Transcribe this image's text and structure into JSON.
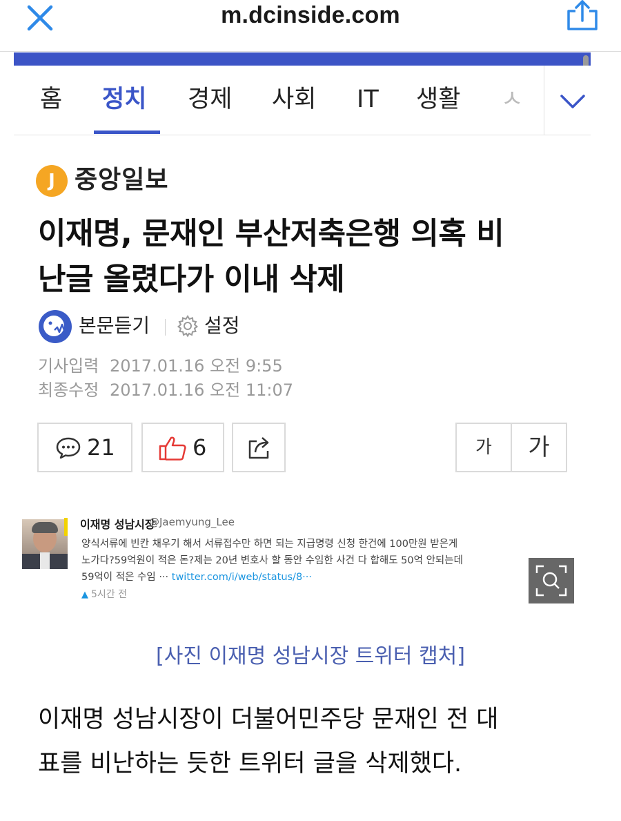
{
  "browser": {
    "url": "m.dcinside.com"
  },
  "nav": {
    "tabs": [
      {
        "label": "홈"
      },
      {
        "label": "정치"
      },
      {
        "label": "경제"
      },
      {
        "label": "사회"
      },
      {
        "label": "IT"
      },
      {
        "label": "생활"
      },
      {
        "label": "ㅅ"
      }
    ],
    "active_index": 1
  },
  "publisher": {
    "logo_letter": "J",
    "name": "중앙일보"
  },
  "article": {
    "headline_line1": "이재명, 문재인 부산저축은행 의혹 비",
    "headline_line2": "난글 올렸다가 이내 삭제",
    "listen_label": "본문듣기",
    "settings_label": "설정",
    "published_label": "기사입력",
    "published_value": "2017.01.16 오전 9:55",
    "modified_label": "최종수정",
    "modified_value": "2017.01.16 오전 11:07",
    "caption": "[사진 이재명 성남시장 트위터 캡처]",
    "body_line1": "이재명 성남시장이 더불어민주당 문재인 전 대",
    "body_line2": "표를 비난하는 듯한 트위터 글을 삭제했다."
  },
  "actions": {
    "comment_count": "21",
    "like_count": "6",
    "font_small": "가",
    "font_large": "가"
  },
  "tweet": {
    "name": "이재명 성남시장",
    "handle": "@Jaemyung_Lee",
    "line1": "양식서류에 빈칸 채우기 해서 서류접수만 하면 되는 지급명령 신청 한건에 100만원 받은게",
    "line2": "노가다?59억원이 적은 돈?제는 20년 변호사 할 동안 수임한 사건 다 합해도 50억 안되는데",
    "line3_text": "59억이 적은 수임 ··· ",
    "line3_link": "twitter.com/i/web/status/8···",
    "time": "5시간 전"
  },
  "colors": {
    "accent_blue": "#3a55c8",
    "band_blue": "#3c54c6",
    "logo_orange": "#f5a623",
    "like_red": "#e53935"
  }
}
